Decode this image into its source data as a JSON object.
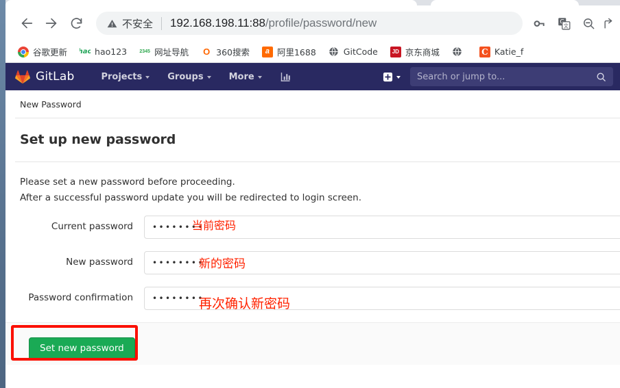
{
  "browser": {
    "nav": {
      "back_label": "Back",
      "forward_label": "Forward",
      "reload_label": "Reload"
    },
    "omnibox": {
      "security_icon": "warning-triangle-icon",
      "security_label": "不安全",
      "url_host": "192.168.198.11:88",
      "url_path": "/profile/password/new",
      "url_full": "192.168.198.11:88/profile/password/new"
    },
    "toolbar_icons": [
      {
        "name": "password-key-icon",
        "glyph": "key"
      },
      {
        "name": "google-translate-icon",
        "glyph": "translate"
      },
      {
        "name": "zoom-out-icon",
        "glyph": "zoom-out"
      },
      {
        "name": "share-icon",
        "glyph": "share"
      }
    ],
    "bookmarks": [
      {
        "label": "谷歌更新",
        "icon": "chrome-icon"
      },
      {
        "label": "hao123",
        "icon": "hao123-icon"
      },
      {
        "label": "网址导航",
        "icon": "2345-icon"
      },
      {
        "label": "360搜索",
        "icon": "360-icon"
      },
      {
        "label": "阿里1688",
        "icon": "alibaba-icon"
      },
      {
        "label": "GitCode",
        "icon": "globe-icon"
      },
      {
        "label": "京东商城",
        "icon": "jd-icon"
      },
      {
        "label": "",
        "icon": "globe-icon"
      },
      {
        "label": "Katie_f",
        "icon": "katie-icon"
      }
    ]
  },
  "gitlab": {
    "brand": "GitLab",
    "brand_icon": "gitlab-fox-icon",
    "menu": [
      {
        "label": "Projects",
        "has_caret": true
      },
      {
        "label": "Groups",
        "has_caret": true
      },
      {
        "label": "More",
        "has_caret": true
      }
    ],
    "analytics_icon": "bar-chart-icon",
    "new_icon": "plus-square-icon",
    "search": {
      "placeholder": "Search or jump to...",
      "icon": "search-icon"
    },
    "navbar_color": "#292961",
    "search_bg": "#3d3d75"
  },
  "page": {
    "breadcrumb": "New Password",
    "title": "Set up new password",
    "intro_line1": "Please set a new password before proceeding.",
    "intro_line2": "After a successful password update you will be redirected to login screen.",
    "fields": [
      {
        "label": "Current password",
        "value": "••••••••",
        "annotation": "当前密码"
      },
      {
        "label": "New password",
        "value": "••••••••",
        "annotation": "新的密码"
      },
      {
        "label": "Password confirmation",
        "value": "••••••••",
        "annotation": "再次确认新密码"
      }
    ],
    "submit_label": "Set new password",
    "submit_color": "#1aaa55",
    "annotation_color": "#ff2200",
    "highlight_color": "#fb0f00"
  }
}
